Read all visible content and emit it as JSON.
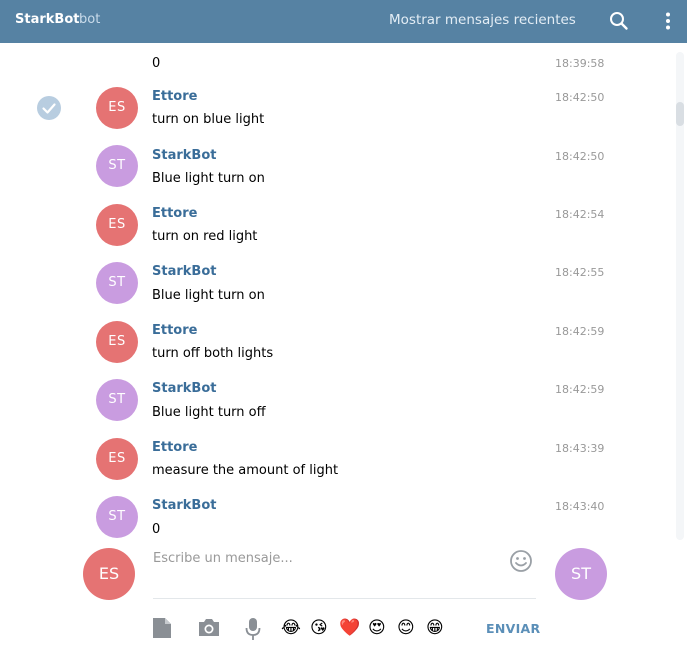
{
  "header": {
    "title": "StarkBot",
    "subtitle": "bot",
    "recent_link": "Mostrar mensajes recientes",
    "bg_color": "#5682a3"
  },
  "messages": [
    {
      "text": "0",
      "time": "18:39:58"
    },
    {
      "sender": "Ettore",
      "initials": "ES",
      "text": "turn on blue light",
      "time": "18:42:50",
      "selected": true
    },
    {
      "sender": "StarkBot",
      "initials": "ST",
      "text": "Blue light turn on",
      "time": "18:42:50"
    },
    {
      "sender": "Ettore",
      "initials": "ES",
      "text": "turn on red light",
      "time": "18:42:54"
    },
    {
      "sender": "StarkBot",
      "initials": "ST",
      "text": "Blue light turn on",
      "time": "18:42:55"
    },
    {
      "sender": "Ettore",
      "initials": "ES",
      "text": "turn off both lights",
      "time": "18:42:59"
    },
    {
      "sender": "StarkBot",
      "initials": "ST",
      "text": "Blue light turn off",
      "time": "18:42:59"
    },
    {
      "sender": "Ettore",
      "initials": "ES",
      "text": "measure the amount of light",
      "time": "18:43:39"
    },
    {
      "sender": "StarkBot",
      "initials": "ST",
      "text": "0",
      "time": "18:43:40"
    }
  ],
  "composer": {
    "my_initials": "ES",
    "peer_initials": "ST",
    "placeholder": "Escribe un mensaje...",
    "value": "",
    "send_label": "ENVIAR",
    "emojis": [
      "😂",
      "😘",
      "❤️",
      "😍",
      "😊",
      "😁"
    ]
  },
  "colors": {
    "accent": "#5682a3",
    "sender_name": "#3a6d99",
    "avatar_es": "#e57373",
    "avatar_st": "#c99ce0"
  }
}
